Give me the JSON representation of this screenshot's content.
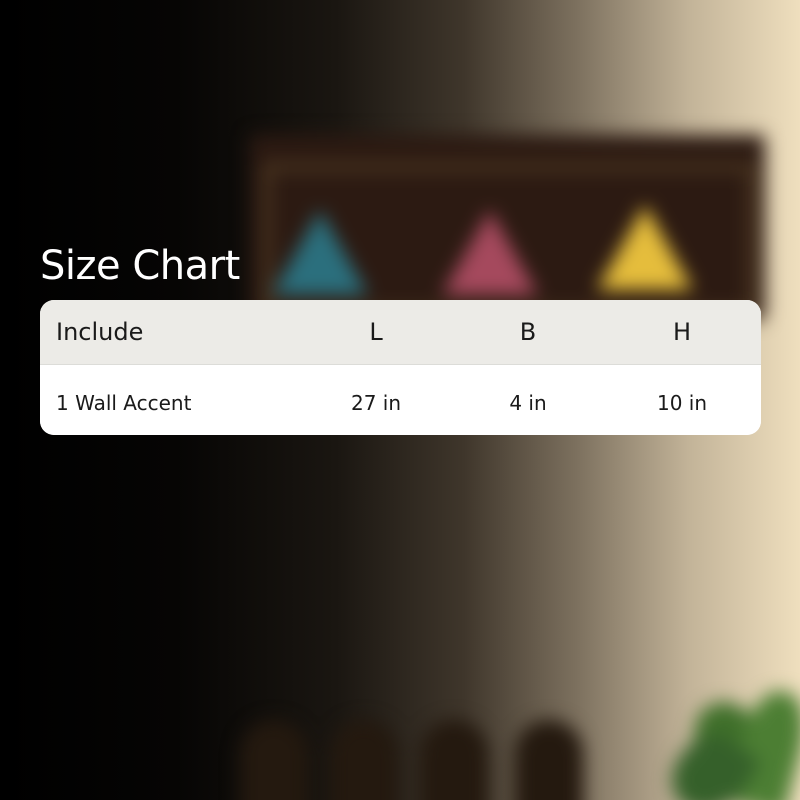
{
  "size_chart": {
    "title": "Size Chart",
    "columns": [
      "Include",
      "L",
      "B",
      "H"
    ],
    "rows": [
      [
        "1 Wall Accent",
        "27 in",
        "4 in",
        "10 in"
      ]
    ]
  },
  "background": {
    "description_colors": {
      "left": "#000000",
      "right": "#efdfbe"
    }
  }
}
